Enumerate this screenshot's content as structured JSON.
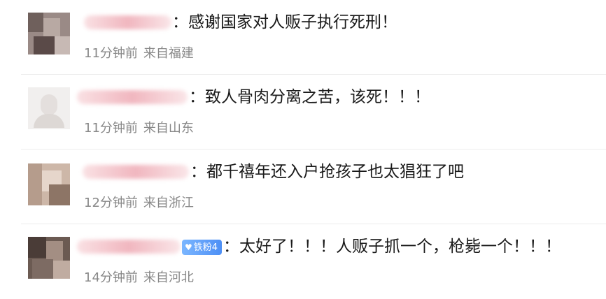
{
  "comments": [
    {
      "separator": "：",
      "text": "感谢国家对人贩子执行死刑！",
      "time": "11分钟前",
      "source": "来自福建"
    },
    {
      "separator": "：",
      "text": "致人骨肉分离之苦，该死！！！",
      "time": "11分钟前",
      "source": "来自山东"
    },
    {
      "separator": "：",
      "text": "都千禧年还入户抢孩子也太猖狂了吧",
      "time": "12分钟前",
      "source": "来自浙江"
    },
    {
      "badge": "铁粉4",
      "separator": "：",
      "text": "太好了！！！人贩子抓一个，枪毙一个！！！",
      "time": "14分钟前",
      "source": "来自河北"
    }
  ],
  "colors": {
    "meta": "#888888",
    "text": "#1a1a1a",
    "badge": "#4d8ff5"
  }
}
